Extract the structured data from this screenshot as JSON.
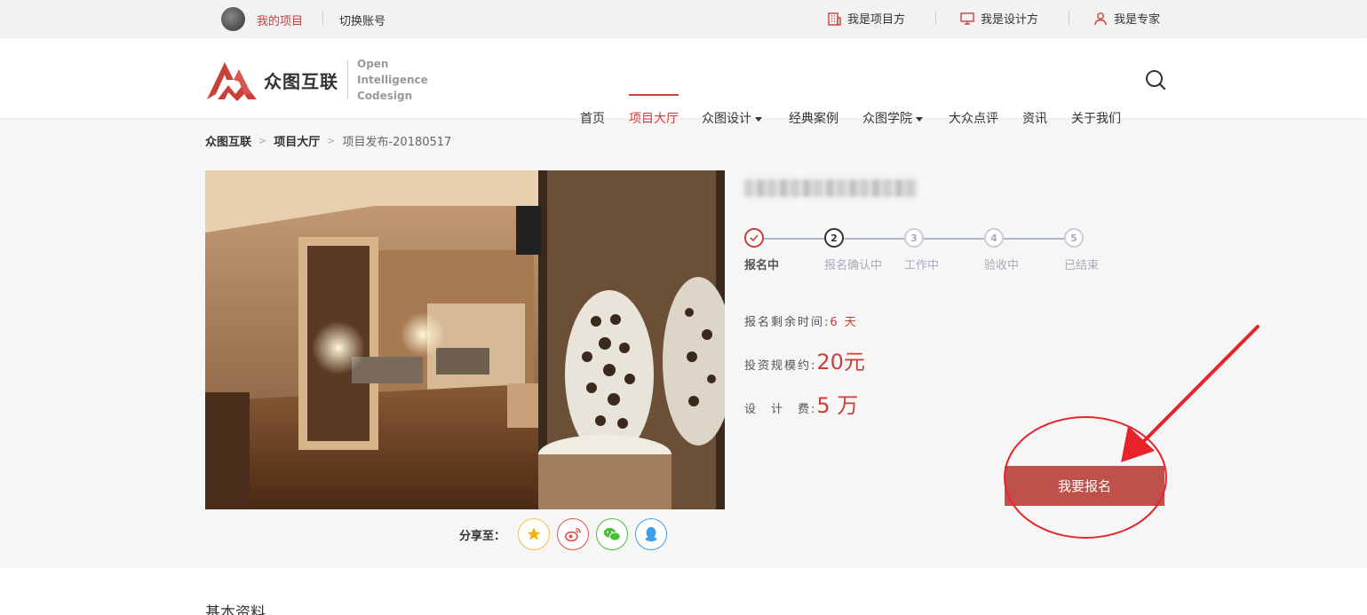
{
  "topbar": {
    "my_projects": "我的项目",
    "switch_account": "切换账号",
    "project_side": "我是项目方",
    "designer_side": "我是设计方",
    "expert_side": "我是专家"
  },
  "logo": {
    "cn": "众图互联",
    "en1": "Open",
    "en2": "Intelligence",
    "en3": "Codesign"
  },
  "nav": {
    "home": "首页",
    "hall": "项目大厅",
    "design": "众图设计",
    "cases": "经典案例",
    "academy": "众图学院",
    "review": "大众点评",
    "news": "资讯",
    "about": "关于我们"
  },
  "breadcrumb": {
    "c1": "众图互联",
    "c2": "项目大厅",
    "c3": "项目发布-20180517",
    "sep": ">"
  },
  "share": {
    "label": "分享至："
  },
  "steps": {
    "s1": "报名中",
    "s2": "报名确认中",
    "s3": "工作中",
    "s4": "验收中",
    "s5": "已结束",
    "n2": "2",
    "n3": "3",
    "n4": "4",
    "n5": "5"
  },
  "info": {
    "remain_label": "报名剩余时间:",
    "remain_value": "6 天",
    "invest_label": "投资规模约:",
    "invest_value": "20元",
    "fee_label": "设　计　费:",
    "fee_value": "5 万"
  },
  "signup_button": "我要报名",
  "section": {
    "basic_info": "基本资料"
  },
  "colors": {
    "accent": "#c9403a",
    "button": "#c0504a",
    "annotation": "#e8232b"
  }
}
